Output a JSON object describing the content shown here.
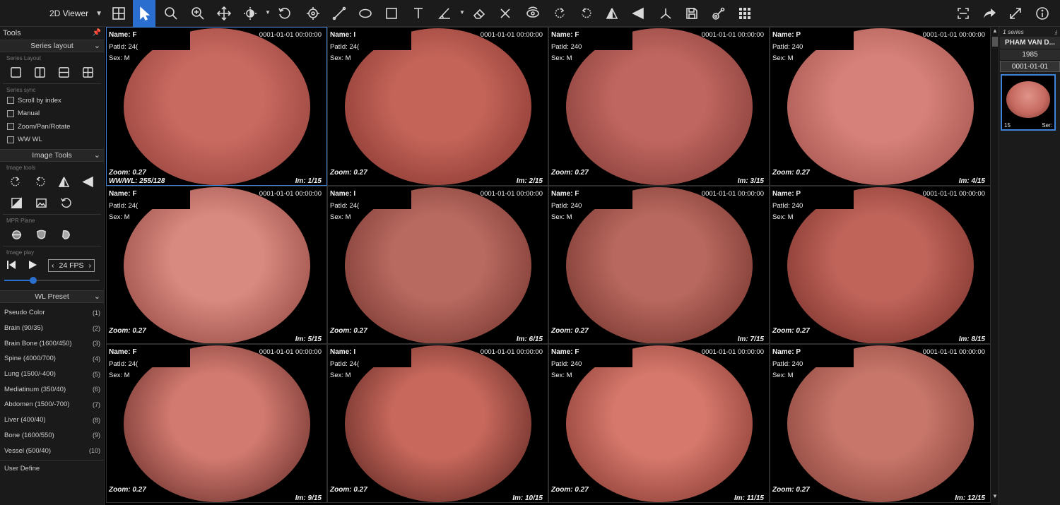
{
  "toolbar": {
    "mode_label": "2D Viewer",
    "tools": [
      "layout-grid",
      "pointer",
      "zoom",
      "zoom-in",
      "pan",
      "window-level",
      "reset",
      "target",
      "ruler",
      "ellipse",
      "rectangle",
      "text",
      "angle",
      "eraser",
      "clear",
      "eye-rotate",
      "rotate-ccw",
      "rotate-cw",
      "flip-vertical",
      "flip-horizontal",
      "axes",
      "save",
      "settings-link",
      "grid-apps",
      "fullscreen-select",
      "share",
      "expand",
      "info"
    ]
  },
  "left_panel": {
    "title": "Tools",
    "series_layout": {
      "header": "Series layout",
      "sub_label": "Series Layout",
      "sync_label": "Series sync",
      "sync_options": [
        "Scroll by index",
        "Manual",
        "Zoom/Pan/Rotate",
        "WW WL"
      ]
    },
    "image_tools": {
      "header": "Image Tools",
      "sub_label": "Image tools",
      "mpr_label": "MPR Plane",
      "play_label": "Image play",
      "fps_label": "24 FPS",
      "slider_fraction": 0.3
    },
    "wl_preset": {
      "header": "WL Preset",
      "items": [
        {
          "label": "Pseudo Color",
          "key": "(1)"
        },
        {
          "label": "Brain  (90/35)",
          "key": "(2)"
        },
        {
          "label": "Brain Bone  (1600/450)",
          "key": "(3)"
        },
        {
          "label": "Spine  (4000/700)",
          "key": "(4)"
        },
        {
          "label": "Lung  (1500/-400)",
          "key": "(5)"
        },
        {
          "label": "Mediatinum  (350/40)",
          "key": "(6)"
        },
        {
          "label": "Abdomen  (1500/-700)",
          "key": "(7)"
        },
        {
          "label": "Liver  (400/40)",
          "key": "(8)"
        },
        {
          "label": "Bone  (1600/550)",
          "key": "(9)"
        },
        {
          "label": "Vessel  (500/40)",
          "key": "(10)"
        }
      ],
      "user_define": "User Define"
    }
  },
  "viewports": [
    {
      "name": "Name: F",
      "patid": "PatId: 24(",
      "sex": "Sex: M",
      "date": "0001-01-01  00:00:00",
      "zoom": "Zoom: 0.27",
      "wl": "WW/WL: 255/128",
      "im": "Im: 1/15",
      "c1": "#c96a60",
      "c2": "#8a3a35"
    },
    {
      "name": "Name: I",
      "patid": "PatId: 24(",
      "sex": "Sex: M",
      "date": "0001-01-01  00:00:00",
      "zoom": "Zoom: 0.27",
      "wl": "",
      "im": "Im: 2/15",
      "c1": "#c46458",
      "c2": "#7e302c"
    },
    {
      "name": "Name: F",
      "patid": "PatId: 240",
      "sex": "Sex: M",
      "date": "0001-01-01  00:00:00",
      "zoom": "Zoom: 0.27",
      "wl": "",
      "im": "Im: 3/15",
      "c1": "#c06660",
      "c2": "#7a3530"
    },
    {
      "name": "Name: P",
      "patid": "PatId: 240",
      "sex": "Sex: M",
      "date": "0001-01-01  00:00:00",
      "zoom": "Zoom: 0.27",
      "wl": "",
      "im": "Im: 4/15",
      "c1": "#d6827a",
      "c2": "#9a4a44"
    },
    {
      "name": "Name: F",
      "patid": "PatId: 24(",
      "sex": "Sex: M",
      "date": "0001-01-01  00:00:00",
      "zoom": "Zoom: 0.27",
      "wl": "",
      "im": "Im: 5/15",
      "c1": "#d88a80",
      "c2": "#8a3e38"
    },
    {
      "name": "Name: I",
      "patid": "PatId: 24(",
      "sex": "Sex: M",
      "date": "0001-01-01  00:00:00",
      "zoom": "Zoom: 0.27",
      "wl": "",
      "im": "Im: 6/15",
      "c1": "#b86a60",
      "c2": "#6e2e28"
    },
    {
      "name": "Name: F",
      "patid": "PatId: 240",
      "sex": "Sex: M",
      "date": "0001-01-01  00:00:00",
      "zoom": "Zoom: 0.27",
      "wl": "",
      "im": "Im: 7/15",
      "c1": "#b8685e",
      "c2": "#6a2c26"
    },
    {
      "name": "Name: P",
      "patid": "PatId: 240",
      "sex": "Sex: M",
      "date": "0001-01-01  00:00:00",
      "zoom": "Zoom: 0.27",
      "wl": "",
      "im": "Im: 8/15",
      "c1": "#c0645a",
      "c2": "#702a24"
    },
    {
      "name": "Name: F",
      "patid": "PatId: 24(",
      "sex": "Sex: M",
      "date": "0001-01-01  00:00:00",
      "zoom": "Zoom: 0.27",
      "wl": "",
      "im": "Im: 9/15",
      "c1": "#d27a70",
      "c2": "#5a2420"
    },
    {
      "name": "Name: I",
      "patid": "PatId: 24(",
      "sex": "Sex: M",
      "date": "0001-01-01  00:00:00",
      "zoom": "Zoom: 0.27",
      "wl": "",
      "im": "Im: 10/15",
      "c1": "#c8685c",
      "c2": "#4e1e1a"
    },
    {
      "name": "Name: F",
      "patid": "PatId: 240",
      "sex": "Sex: M",
      "date": "0001-01-01  00:00:00",
      "zoom": "Zoom: 0.27",
      "wl": "",
      "im": "Im: 11/15",
      "c1": "#d6786c",
      "c2": "#7a3028"
    },
    {
      "name": "Name: P",
      "patid": "PatId: 240",
      "sex": "Sex: M",
      "date": "0001-01-01  00:00:00",
      "zoom": "Zoom: 0.27",
      "wl": "",
      "im": "Im: 12/15",
      "c1": "#c8766a",
      "c2": "#7c3a32"
    }
  ],
  "right_panel": {
    "series_count": "1 series",
    "patient_name": "PHAM VAN D...",
    "birth_year": "1985",
    "study_date": "0001-01-01",
    "thumb_count": "15",
    "thumb_series": "Ser:"
  },
  "colors": {
    "accent": "#2a6fd0",
    "selected_border": "#3f83d8",
    "panel_bg": "#1a1a1a"
  }
}
